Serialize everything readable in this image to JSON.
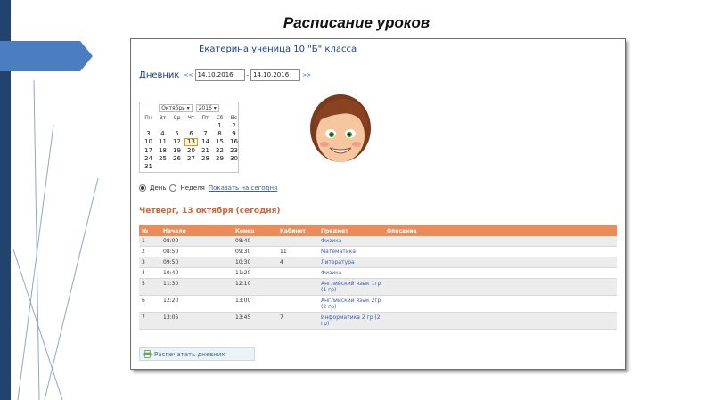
{
  "slide": {
    "title": "Расписание уроков"
  },
  "colors": {
    "left_bar": "#22436e",
    "arrow": "#4a7ec1",
    "table_header": "#ee8a57",
    "day_heading": "#d0663c",
    "link": "#3a5bb0"
  },
  "header": {
    "student": "Екатерина ученица 10 \"Б\" класса"
  },
  "diary": {
    "label": "Дневник",
    "prev": "<<",
    "date_from": "14.10.2016",
    "dash": "-",
    "date_to": "14.10.2016",
    "next": ">>"
  },
  "calendar": {
    "month": "Октябрь ▾",
    "year": "2016 ▾",
    "weekdays": [
      "Пн",
      "Вт",
      "Ср",
      "Чт",
      "Пт",
      "Сб",
      "Вс"
    ],
    "weeks": [
      [
        "",
        "",
        "",
        "",
        "",
        "1",
        "2"
      ],
      [
        "3",
        "4",
        "5",
        "6",
        "7",
        "8",
        "9"
      ],
      [
        "10",
        "11",
        "12",
        "13",
        "14",
        "15",
        "16"
      ],
      [
        "17",
        "18",
        "19",
        "20",
        "21",
        "22",
        "23"
      ],
      [
        "24",
        "25",
        "26",
        "27",
        "28",
        "29",
        "30"
      ],
      [
        "31",
        "",
        "",
        "",
        "",
        "",
        ""
      ]
    ],
    "today": "13"
  },
  "mode": {
    "day": "День",
    "week": "Неделя",
    "today_link": "Показать на сегодня"
  },
  "day_heading": "Четверг, 13 октября (сегодня)",
  "schedule": {
    "columns": [
      "№",
      "Начало",
      "Конец",
      "Кабинет",
      "Предмет",
      "Описание"
    ],
    "rows": [
      {
        "n": "1",
        "start": "08:00",
        "end": "08:40",
        "room": "",
        "subject": "Физика"
      },
      {
        "n": "2",
        "start": "08:50",
        "end": "09:30",
        "room": "11",
        "subject": "Математика"
      },
      {
        "n": "3",
        "start": "09:50",
        "end": "10:30",
        "room": "4",
        "subject": "Литература"
      },
      {
        "n": "4",
        "start": "10:40",
        "end": "11:20",
        "room": "",
        "subject": "Физика"
      },
      {
        "n": "5",
        "start": "11:30",
        "end": "12:10",
        "room": "",
        "subject": "Английский язык 1гр (1 гр)"
      },
      {
        "n": "6",
        "start": "12:20",
        "end": "13:00",
        "room": "",
        "subject": "Английский язык 2гр (2 гр)"
      },
      {
        "n": "7",
        "start": "13:05",
        "end": "13:45",
        "room": "7",
        "subject": "Информатика 2 гр (2 гр)"
      }
    ]
  },
  "print_button": "Распечатать дневник"
}
